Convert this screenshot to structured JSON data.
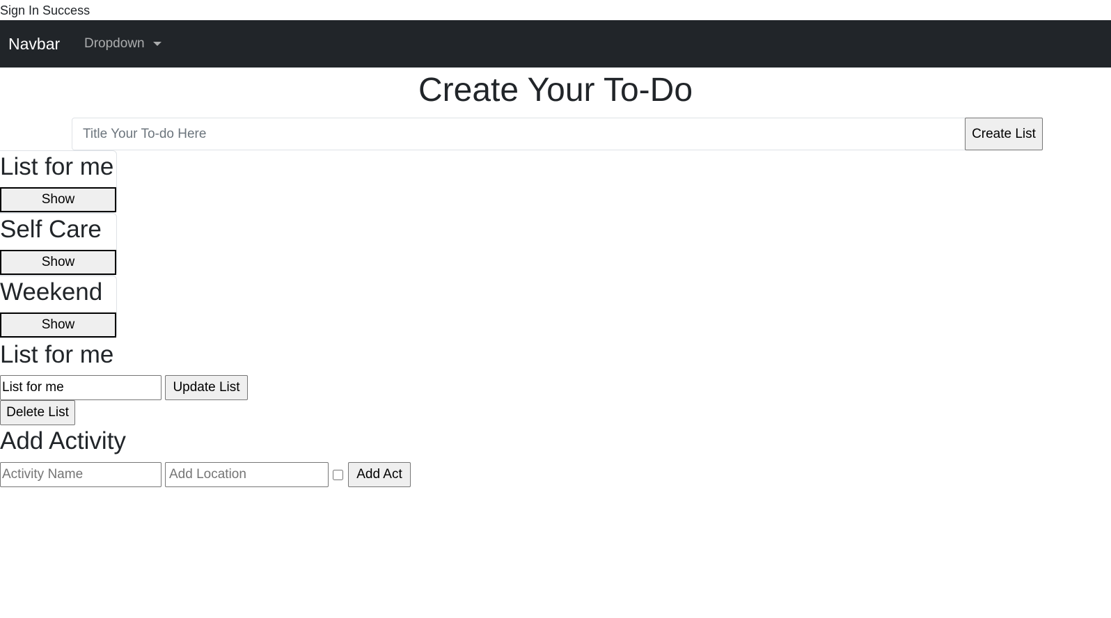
{
  "status": {
    "message": "Sign In Success"
  },
  "navbar": {
    "brand": "Navbar",
    "dropdown_label": "Dropdown"
  },
  "main": {
    "title": "Create Your To-Do",
    "title_input_placeholder": "Title Your To-do Here",
    "create_button": "Create List"
  },
  "lists": [
    {
      "title": "List for me",
      "show_label": "Show"
    },
    {
      "title": "Self Care",
      "show_label": "Show"
    },
    {
      "title": "Weekend",
      "show_label": "Show"
    }
  ],
  "selected_list": {
    "heading": "List for me",
    "name_value": "List for me",
    "update_button": "Update List",
    "delete_button": "Delete List"
  },
  "add_activity": {
    "heading": "Add Activity",
    "name_placeholder": "Activity Name",
    "location_placeholder": "Add Location",
    "checkbox_checked": false,
    "add_button": "Add Act"
  }
}
